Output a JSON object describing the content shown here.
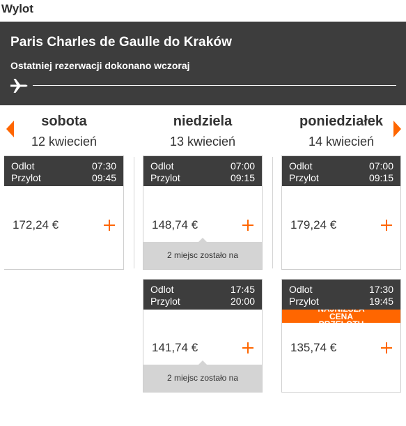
{
  "page": {
    "title": "Wylot"
  },
  "route": {
    "title": "Paris Charles de Gaulle do Kraków",
    "subtitle": "Ostatniej rezerwacji dokonano wczoraj"
  },
  "days": [
    {
      "name": "sobota",
      "date": "12 kwiecień"
    },
    {
      "name": "niedziela",
      "date": "13 kwiecień"
    },
    {
      "name": "poniedziałek",
      "date": "14 kwiecień"
    }
  ],
  "labels": {
    "departure": "Odlot",
    "arrival": "Przylot"
  },
  "flights": [
    {
      "dep": "07:30",
      "arr": "09:45",
      "price": "172,24 €"
    },
    {
      "dep": "07:00",
      "arr": "09:15",
      "price": "148,74 €",
      "seats": "2 miejsc zostało na"
    },
    {
      "dep": "07:00",
      "arr": "09:15",
      "price": "179,24 €"
    },
    {
      "dep": "17:45",
      "arr": "20:00",
      "price": "141,74 €",
      "seats": "2 miejsc zostało na"
    },
    {
      "dep": "17:30",
      "arr": "19:45",
      "price": "135,74 €",
      "banner": "NAJNIŻSZA CENA PRZELOTU"
    }
  ],
  "colors": {
    "accent": "#ff6600",
    "header": "#3d3d3d",
    "seats_bg": "#d4d4d4"
  },
  "icons": {
    "plane": "plane-icon",
    "prev": "arrow-left-icon",
    "next": "arrow-right-icon",
    "add": "plus-icon"
  }
}
